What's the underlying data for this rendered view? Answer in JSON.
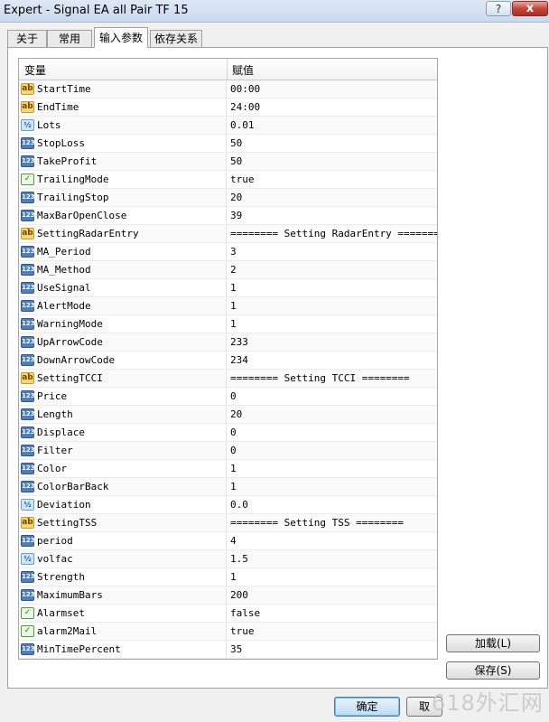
{
  "window": {
    "title": "Expert - Signal EA all Pair TF 15",
    "help_label": "?",
    "close_label": "x"
  },
  "tabs": [
    {
      "label": "关于"
    },
    {
      "label": "常用"
    },
    {
      "label": "输入参数"
    },
    {
      "label": "依存关系"
    }
  ],
  "grid": {
    "col_variable": "变量",
    "col_value": "赋值"
  },
  "params": [
    {
      "type": "ab",
      "name": "StartTime",
      "value": "00:00"
    },
    {
      "type": "ab",
      "name": "EndTime",
      "value": "24:00"
    },
    {
      "type": "12",
      "name": "Lots",
      "value": "0.01"
    },
    {
      "type": "123",
      "name": "StopLoss",
      "value": "50"
    },
    {
      "type": "123",
      "name": "TakeProfit",
      "value": "50"
    },
    {
      "type": "bool",
      "name": "TrailingMode",
      "value": "true"
    },
    {
      "type": "123",
      "name": "TrailingStop",
      "value": "20"
    },
    {
      "type": "123",
      "name": "MaxBarOpenClose",
      "value": "39"
    },
    {
      "type": "ab",
      "name": "SettingRadarEntry",
      "value": "======== Setting RadarEntry ========"
    },
    {
      "type": "123",
      "name": "MA_Period",
      "value": "3"
    },
    {
      "type": "123",
      "name": "MA_Method",
      "value": "2"
    },
    {
      "type": "123",
      "name": "UseSignal",
      "value": "1"
    },
    {
      "type": "123",
      "name": "AlertMode",
      "value": "1"
    },
    {
      "type": "123",
      "name": "WarningMode",
      "value": "1"
    },
    {
      "type": "123",
      "name": "UpArrowCode",
      "value": "233"
    },
    {
      "type": "123",
      "name": "DownArrowCode",
      "value": "234"
    },
    {
      "type": "ab",
      "name": "SettingTCCI",
      "value": "======== Setting TCCI ========"
    },
    {
      "type": "123",
      "name": "Price",
      "value": "0"
    },
    {
      "type": "123",
      "name": "Length",
      "value": "20"
    },
    {
      "type": "123",
      "name": "Displace",
      "value": "0"
    },
    {
      "type": "123",
      "name": "Filter",
      "value": "0"
    },
    {
      "type": "123",
      "name": "Color",
      "value": "1"
    },
    {
      "type": "123",
      "name": "ColorBarBack",
      "value": "1"
    },
    {
      "type": "12",
      "name": "Deviation",
      "value": "0.0"
    },
    {
      "type": "ab",
      "name": "SettingTSS",
      "value": "======== Setting TSS ========"
    },
    {
      "type": "123",
      "name": "period",
      "value": "4"
    },
    {
      "type": "12",
      "name": "volfac",
      "value": "1.5"
    },
    {
      "type": "123",
      "name": "Strength",
      "value": "1"
    },
    {
      "type": "123",
      "name": "MaximumBars",
      "value": "200"
    },
    {
      "type": "bool",
      "name": "Alarmset",
      "value": "false"
    },
    {
      "type": "bool",
      "name": "alarm2Mail",
      "value": "true"
    },
    {
      "type": "123",
      "name": "MinTimePercent",
      "value": "35"
    }
  ],
  "icon_glyphs": {
    "ab": "ab",
    "123": "123",
    "12": "½",
    "bool": "✓"
  },
  "buttons": {
    "load": "加载(L)",
    "save": "保存(S)",
    "ok": "确定",
    "cancel": "取"
  },
  "watermark": "618外汇网"
}
